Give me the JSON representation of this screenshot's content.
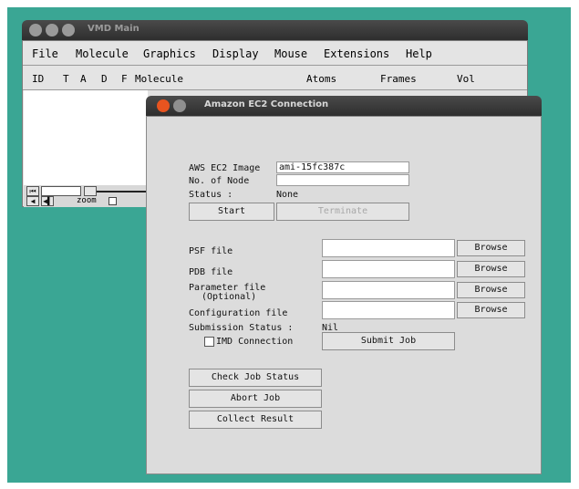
{
  "vmd_main": {
    "title": "VMD Main",
    "menu": [
      "File",
      "Molecule",
      "Graphics",
      "Display",
      "Mouse",
      "Extensions",
      "Help"
    ],
    "columns": [
      "ID",
      "T",
      "A",
      "D",
      "F",
      "Molecule",
      "Atoms",
      "Frames",
      "Vol"
    ],
    "zoom_label": "zoom"
  },
  "ec2": {
    "title": "Amazon EC2 Connection",
    "aws_image_label": "AWS EC2 Image",
    "aws_image_value": "ami-15fc387c",
    "num_node_label": "No. of Node",
    "num_node_value": "",
    "status_label": "Status :",
    "status_value": "None",
    "start_label": "Start",
    "terminate_label": "Terminate",
    "psf_label": "PSF file",
    "pdb_label": "PDB file",
    "param_label_1": "Parameter file",
    "param_label_2": "(Optional)",
    "config_label": "Configuration file",
    "browse_label": "Browse",
    "submission_status_label": "Submission Status :",
    "submission_status_value": "Nil",
    "imd_label": "IMD Connection",
    "submit_label": "Submit Job",
    "check_status_label": "Check Job Status",
    "abort_label": "Abort Job",
    "collect_label": "Collect Result"
  }
}
